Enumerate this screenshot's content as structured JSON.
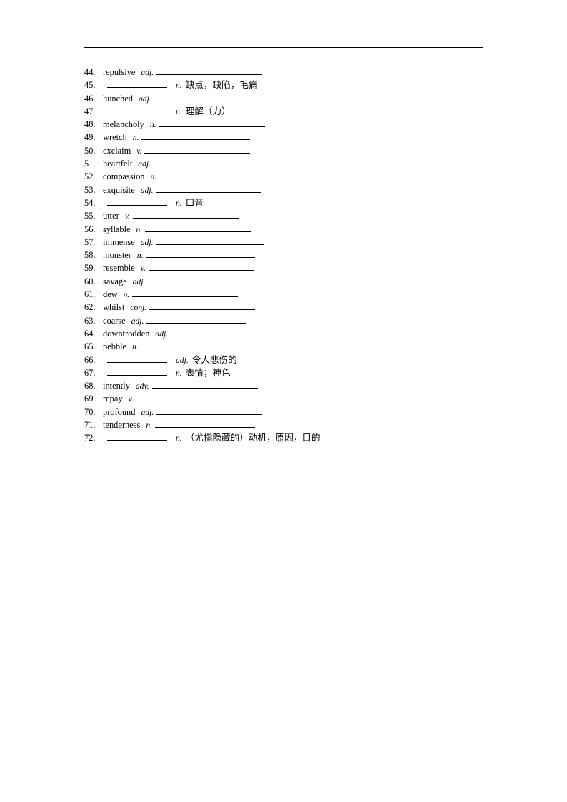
{
  "document": {
    "type": "vocabulary-worksheet",
    "header_rule": true,
    "page_background": "#ffffff",
    "text_color": "#000000"
  },
  "entries": [
    {
      "number": "44.",
      "word": "repulsive",
      "pos": "adj.",
      "blank_width": 148,
      "chinese": "",
      "layout": "word"
    },
    {
      "number": "45.",
      "word": "",
      "pos": "n.",
      "blank_width": 84,
      "chinese": "缺点，缺陷，毛病",
      "layout": "blank"
    },
    {
      "number": "46.",
      "word": "hunched",
      "pos": "adj.",
      "blank_width": 152,
      "chinese": "",
      "layout": "word"
    },
    {
      "number": "47.",
      "word": "",
      "pos": "n.",
      "blank_width": 84,
      "chinese": "理解（力）",
      "layout": "blank"
    },
    {
      "number": "48.",
      "word": "melancholy",
      "pos": "n.",
      "blank_width": 148,
      "chinese": "",
      "layout": "word"
    },
    {
      "number": "49.",
      "word": "wretch",
      "pos": "n.",
      "blank_width": 152,
      "chinese": "",
      "layout": "word"
    },
    {
      "number": "50.",
      "word": "exclaim",
      "pos": "v.",
      "blank_width": 148,
      "chinese": "",
      "layout": "word"
    },
    {
      "number": "51.",
      "word": "heartfelt",
      "pos": "adj.",
      "blank_width": 148,
      "chinese": "",
      "layout": "word"
    },
    {
      "number": "52.",
      "word": "compassion",
      "pos": "n.",
      "blank_width": 146,
      "chinese": "",
      "layout": "word"
    },
    {
      "number": "53.",
      "word": "exquisite",
      "pos": "adj.",
      "blank_width": 148,
      "chinese": "",
      "layout": "word"
    },
    {
      "number": "54.",
      "word": "",
      "pos": "n.",
      "blank_width": 84,
      "chinese": "口音",
      "layout": "blank"
    },
    {
      "number": "55.",
      "word": "utter",
      "pos": "v.",
      "blank_width": 148,
      "chinese": "",
      "layout": "word"
    },
    {
      "number": "56.",
      "word": "syllable",
      "pos": "n.",
      "blank_width": 148,
      "chinese": "",
      "layout": "word"
    },
    {
      "number": "57.",
      "word": "immense",
      "pos": "adj.",
      "blank_width": 152,
      "chinese": "",
      "layout": "word"
    },
    {
      "number": "58.",
      "word": "monster",
      "pos": "n.",
      "blank_width": 152,
      "chinese": "",
      "layout": "word"
    },
    {
      "number": "59.",
      "word": "resemble",
      "pos": "v.",
      "blank_width": 148,
      "chinese": "",
      "layout": "word"
    },
    {
      "number": "60.",
      "word": "savage",
      "pos": "adj.",
      "blank_width": 148,
      "chinese": "",
      "layout": "word"
    },
    {
      "number": "61.",
      "word": "dew",
      "pos": "n.",
      "blank_width": 148,
      "chinese": "",
      "layout": "word"
    },
    {
      "number": "62.",
      "word": "whilst",
      "pos": "conj.",
      "blank_width": 148,
      "chinese": "",
      "layout": "word"
    },
    {
      "number": "63.",
      "word": "coarse",
      "pos": "adj.",
      "blank_width": 140,
      "chinese": "",
      "layout": "word"
    },
    {
      "number": "64.",
      "word": "downtrodden",
      "pos": "adj.",
      "blank_width": 152,
      "chinese": "",
      "layout": "word"
    },
    {
      "number": "65.",
      "word": "pebble",
      "pos": "n.",
      "blank_width": 140,
      "chinese": "",
      "layout": "word"
    },
    {
      "number": "66.",
      "word": "",
      "pos": "adj.",
      "blank_width": 84,
      "chinese": "令人悲伤的",
      "layout": "blank"
    },
    {
      "number": "67.",
      "word": "",
      "pos": "n.",
      "blank_width": 84,
      "chinese": "表情；神色",
      "layout": "blank"
    },
    {
      "number": "68.",
      "word": "intently",
      "pos": "adv.",
      "blank_width": 148,
      "chinese": "",
      "layout": "word"
    },
    {
      "number": "69.",
      "word": "repay",
      "pos": "v.",
      "blank_width": 140,
      "chinese": "",
      "layout": "word"
    },
    {
      "number": "70.",
      "word": "profound",
      "pos": "adj.",
      "blank_width": 148,
      "chinese": "",
      "layout": "word"
    },
    {
      "number": "71.",
      "word": "tenderness",
      "pos": "n.",
      "blank_width": 140,
      "chinese": "",
      "layout": "word"
    },
    {
      "number": "72.",
      "word": "",
      "pos": "n.",
      "blank_width": 84,
      "chinese": "（尤指隐藏的）动机，原因，目的",
      "layout": "blank"
    }
  ]
}
